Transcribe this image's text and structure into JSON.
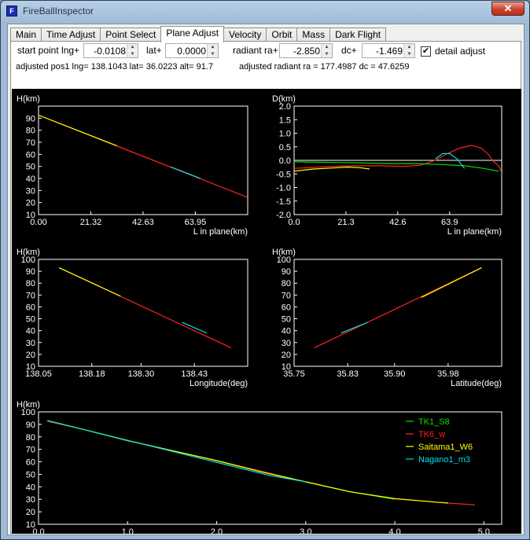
{
  "window": {
    "title": "FireBallInspector",
    "close_glyph": "✕",
    "icon_glyph": "F"
  },
  "tabs": [
    {
      "label": "Main"
    },
    {
      "label": "Time Adjust"
    },
    {
      "label": "Point Select"
    },
    {
      "label": "Plane Adjust",
      "active": true
    },
    {
      "label": "Velocity"
    },
    {
      "label": "Orbit"
    },
    {
      "label": "Mass"
    },
    {
      "label": "Dark Flight"
    }
  ],
  "controls": {
    "start_point_label": "start point  lng+",
    "lng_value": "-0.0108",
    "lat_label": "lat+",
    "lat_value": "0.0000",
    "radiant_label": "radiant ra+",
    "ra_value": "-2.850",
    "dc_label": "dc+",
    "dc_value": "-1.469",
    "detail_label": "detail adjust",
    "detail_checked": "✔"
  },
  "status": {
    "pos": "adjusted pos1  lng= 138.1043   lat= 36.0223  alt= 91.7",
    "radiant": "adjusted radiant ra = 177.4987   dc = 47.6259"
  },
  "colors": {
    "TK1_S8": "#00e000",
    "TK6_w": "#ff2020",
    "Saitama1_W6": "#ffff00",
    "Nagano1_m3": "#00e0e0",
    "axis": "#ffffff",
    "background": "#000000"
  },
  "chart_data": [
    {
      "type": "line",
      "id": "h-vs-l",
      "ylabel": "H(km)",
      "xlabel": "L in plane(km)",
      "xticks": [
        "0.00",
        "21.32",
        "42.63",
        "63.95"
      ],
      "yticks": [
        "10",
        "20",
        "30",
        "40",
        "50",
        "60",
        "70",
        "80",
        "90"
      ],
      "xlim": [
        0,
        85.3
      ],
      "ylim": [
        10,
        100
      ],
      "series": [
        {
          "name": "TK6_w",
          "x": [
            0,
            85
          ],
          "y": [
            92.5,
            24.5
          ]
        },
        {
          "name": "Saitama1_W6",
          "x": [
            0,
            32
          ],
          "y": [
            92.5,
            67
          ]
        },
        {
          "name": "Nagano1_m3",
          "x": [
            54,
            66
          ],
          "y": [
            49.5,
            40
          ]
        }
      ]
    },
    {
      "type": "line",
      "id": "d-vs-l",
      "ylabel": "D(km)",
      "xlabel": "L in plane(km)",
      "xticks": [
        "0.0",
        "21.3",
        "42.6",
        "63.9"
      ],
      "yticks": [
        "-2.0",
        "-1.5",
        "-1.0",
        "-0.5",
        "0.0",
        "0.5",
        "1.0",
        "1.5",
        "2.0"
      ],
      "xlim": [
        0,
        85.3
      ],
      "ylim": [
        -2,
        2
      ],
      "series": [
        {
          "name": "TK1_S8",
          "x": [
            0,
            10,
            20,
            30,
            40,
            50,
            60,
            70,
            78,
            84
          ],
          "y": [
            -0.05,
            -0.07,
            -0.08,
            -0.1,
            -0.12,
            -0.12,
            -0.15,
            -0.2,
            -0.3,
            -0.4
          ]
        },
        {
          "name": "TK6_w",
          "x": [
            0,
            15,
            25,
            35,
            45,
            52,
            58,
            63,
            68,
            73,
            77,
            80,
            82,
            84,
            85
          ],
          "y": [
            -0.3,
            -0.22,
            -0.2,
            -0.2,
            -0.22,
            -0.18,
            0,
            0.25,
            0.45,
            0.55,
            0.45,
            0.2,
            -0.05,
            -0.2,
            -0.4
          ]
        },
        {
          "name": "Saitama1_W6",
          "x": [
            0,
            8,
            16,
            22,
            27,
            31
          ],
          "y": [
            -0.4,
            -0.32,
            -0.28,
            -0.25,
            -0.27,
            -0.32
          ]
        },
        {
          "name": "Nagano1_m3",
          "x": [
            58,
            61,
            64,
            67,
            70
          ],
          "y": [
            0.05,
            0.25,
            0.25,
            0.05,
            -0.3
          ]
        }
      ]
    },
    {
      "type": "line",
      "id": "h-vs-lng",
      "ylabel": "H(km)",
      "xlabel": "Longitude(deg)",
      "xticks": [
        "138.05",
        "138.18",
        "138.30",
        "138.43"
      ],
      "yticks": [
        "10",
        "20",
        "30",
        "40",
        "50",
        "60",
        "70",
        "80",
        "90",
        "100"
      ],
      "xlim": [
        138.05,
        138.56
      ],
      "ylim": [
        10,
        100
      ],
      "series": [
        {
          "name": "TK6_w",
          "x": [
            138.1,
            138.52
          ],
          "y": [
            93,
            25.5
          ]
        },
        {
          "name": "Saitama1_W6",
          "x": [
            138.1,
            138.25
          ],
          "y": [
            93,
            69
          ]
        },
        {
          "name": "Nagano1_m3",
          "x": [
            138.4,
            138.46
          ],
          "y": [
            47,
            38
          ]
        }
      ]
    },
    {
      "type": "line",
      "id": "h-vs-lat",
      "ylabel": "H(km)",
      "xlabel": "Latitude(deg)",
      "xticks": [
        "35.75",
        "35.83",
        "35.90",
        "35.98"
      ],
      "yticks": [
        "10",
        "20",
        "30",
        "40",
        "50",
        "60",
        "70",
        "80",
        "90",
        "100"
      ],
      "xlim": [
        35.75,
        36.06
      ],
      "ylim": [
        10,
        100
      ],
      "series": [
        {
          "name": "TK6_w",
          "x": [
            35.78,
            36.03
          ],
          "y": [
            25.5,
            93
          ]
        },
        {
          "name": "Saitama1_W6",
          "x": [
            35.94,
            36.03
          ],
          "y": [
            68,
            93
          ]
        },
        {
          "name": "Nagano1_m3",
          "x": [
            35.82,
            35.86
          ],
          "y": [
            38,
            47
          ]
        }
      ]
    },
    {
      "type": "line",
      "id": "h-vs-time",
      "ylabel": "H(km)",
      "xlabel": "Time(sec)",
      "xticks": [
        "0.0",
        "1.0",
        "2.0",
        "3.0",
        "4.0",
        "5.0"
      ],
      "yticks": [
        "10",
        "20",
        "30",
        "40",
        "50",
        "60",
        "70",
        "80",
        "90",
        "100"
      ],
      "xlim": [
        0,
        5.2
      ],
      "ylim": [
        10,
        100
      ],
      "legend": "top-right",
      "series": [
        {
          "name": "TK1_S8",
          "x": [
            0.1,
            0.5,
            1,
            1.5,
            2,
            2.5,
            3,
            3.5,
            4
          ],
          "y": [
            93,
            86,
            77,
            69,
            61,
            52,
            44,
            36,
            30
          ]
        },
        {
          "name": "TK6_w",
          "x": [
            0.1,
            0.5,
            1,
            1.5,
            2,
            2.5,
            3,
            3.5,
            4,
            4.5,
            4.9
          ],
          "y": [
            92.5,
            86,
            77,
            69,
            61,
            52.5,
            44,
            36,
            30.5,
            27.5,
            25.5
          ]
        },
        {
          "name": "Saitama1_W6",
          "x": [
            0.1,
            0.5,
            1,
            1.5,
            2,
            2.5,
            3,
            3.5,
            4,
            4.5,
            4.6
          ],
          "y": [
            93,
            86,
            77,
            69,
            61,
            52,
            44,
            36,
            30.5,
            27.5,
            27
          ]
        },
        {
          "name": "Nagano1_m3",
          "x": [
            0.1,
            0.5,
            2.6,
            3.0
          ],
          "y": [
            93,
            86,
            49,
            44
          ]
        }
      ]
    }
  ]
}
